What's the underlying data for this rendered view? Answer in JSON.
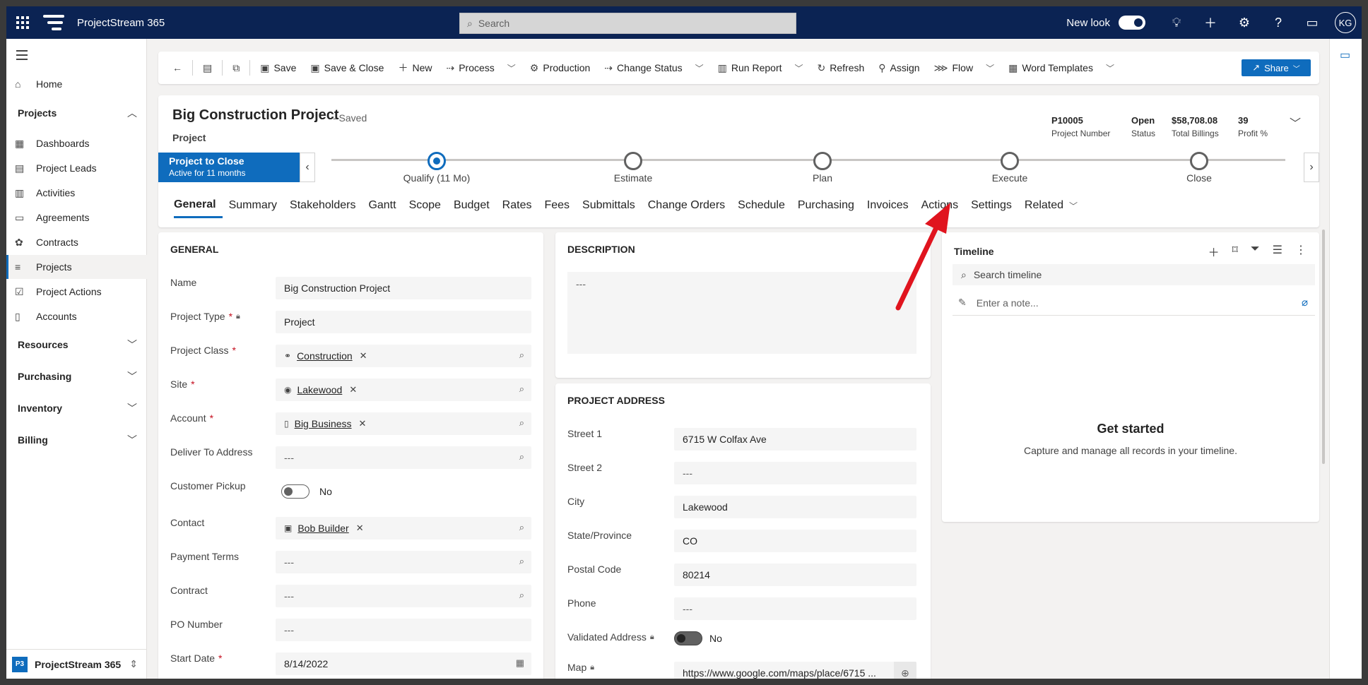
{
  "app": {
    "title": "ProjectStream 365",
    "search_placeholder": "Search",
    "new_look": "New look",
    "user_initials": "KG"
  },
  "nav": {
    "top_items": [
      {
        "label": "Home",
        "icon": "home-icon"
      }
    ],
    "group_projects": "Projects",
    "project_items": [
      {
        "label": "Dashboards",
        "icon": "dashboard-icon"
      },
      {
        "label": "Project Leads",
        "icon": "leads-icon"
      },
      {
        "label": "Activities",
        "icon": "activities-icon"
      },
      {
        "label": "Agreements",
        "icon": "agreements-icon"
      },
      {
        "label": "Contracts",
        "icon": "contracts-icon"
      },
      {
        "label": "Projects",
        "icon": "projects-icon"
      },
      {
        "label": "Project Actions",
        "icon": "actions-icon"
      },
      {
        "label": "Accounts",
        "icon": "accounts-icon"
      }
    ],
    "groups": [
      "Resources",
      "Purchasing",
      "Inventory",
      "Billing"
    ],
    "area": {
      "badge": "P3",
      "label": "ProjectStream 365"
    }
  },
  "commands": {
    "save": "Save",
    "save_close": "Save & Close",
    "new": "New",
    "process": "Process",
    "production": "Production",
    "change_status": "Change Status",
    "run_report": "Run Report",
    "refresh": "Refresh",
    "assign": "Assign",
    "flow": "Flow",
    "word_templates": "Word Templates",
    "share": "Share"
  },
  "record": {
    "title": "Big Construction Project",
    "saved": "- Saved",
    "entity": "Project",
    "kpis": [
      {
        "value": "P10005",
        "label": "Project Number"
      },
      {
        "value": "Open",
        "label": "Status"
      },
      {
        "value": "$58,708.08",
        "label": "Total Billings"
      },
      {
        "value": "39",
        "label": "Profit %"
      }
    ]
  },
  "bpf": {
    "active_title": "Project to Close",
    "active_sub": "Active for 11 months",
    "stages": [
      "Qualify  (11 Mo)",
      "Estimate",
      "Plan",
      "Execute",
      "Close"
    ]
  },
  "tabs": [
    "General",
    "Summary",
    "Stakeholders",
    "Gantt",
    "Scope",
    "Budget",
    "Rates",
    "Fees",
    "Submittals",
    "Change Orders",
    "Schedule",
    "Purchasing",
    "Invoices",
    "Actions",
    "Settings",
    "Related"
  ],
  "general": {
    "title": "GENERAL",
    "fields": {
      "name": {
        "label": "Name",
        "value": "Big Construction Project"
      },
      "project_type": {
        "label": "Project Type",
        "value": "Project"
      },
      "project_class": {
        "label": "Project Class",
        "value": "Construction"
      },
      "site": {
        "label": "Site",
        "value": "Lakewood"
      },
      "account": {
        "label": "Account",
        "value": "Big Business"
      },
      "deliver_to": {
        "label": "Deliver To Address",
        "value": "---"
      },
      "customer_pickup": {
        "label": "Customer Pickup",
        "value": "No"
      },
      "contact": {
        "label": "Contact",
        "value": "Bob Builder"
      },
      "payment_terms": {
        "label": "Payment Terms",
        "value": "---"
      },
      "contract": {
        "label": "Contract",
        "value": "---"
      },
      "po_number": {
        "label": "PO Number",
        "value": "---"
      },
      "start_date": {
        "label": "Start Date",
        "value": "8/14/2022"
      }
    }
  },
  "description": {
    "title": "DESCRIPTION",
    "value": "---"
  },
  "address": {
    "title": "PROJECT ADDRESS",
    "fields": {
      "street1": {
        "label": "Street 1",
        "value": "6715 W Colfax Ave"
      },
      "street2": {
        "label": "Street 2",
        "value": "---"
      },
      "city": {
        "label": "City",
        "value": "Lakewood"
      },
      "state": {
        "label": "State/Province",
        "value": "CO"
      },
      "postal": {
        "label": "Postal Code",
        "value": "80214"
      },
      "phone": {
        "label": "Phone",
        "value": "---"
      },
      "validated": {
        "label": "Validated Address",
        "value": "No"
      },
      "map": {
        "label": "Map",
        "value": "https://www.google.com/maps/place/6715 ..."
      }
    }
  },
  "timeline": {
    "title": "Timeline",
    "search_placeholder": "Search timeline",
    "note_placeholder": "Enter a note...",
    "empty_title": "Get started",
    "empty_caption": "Capture and manage all records in your timeline."
  },
  "colors": {
    "topbar": "#0b2353",
    "accent": "#0f6cbd",
    "annotation_arrow": "#e0141e"
  }
}
